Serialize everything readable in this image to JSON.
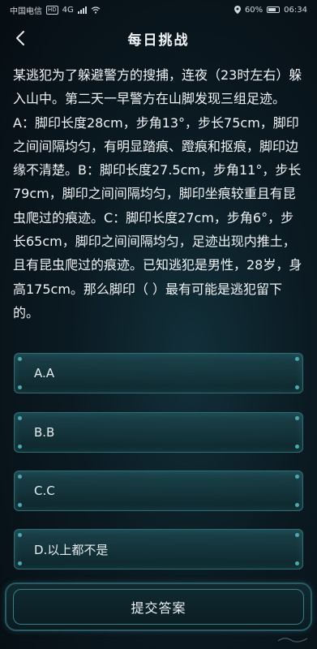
{
  "status_bar": {
    "carrier": "中国电信",
    "network_badge": "HD",
    "network_type": "4G",
    "battery": "60%",
    "time": "06:34"
  },
  "header": {
    "title": "每日挑战",
    "back_icon": "chevron-left-icon"
  },
  "question": {
    "text": "某逃犯为了躲避警方的搜捕，连夜（23时左右）躲入山中。第二天一早警方在山脚发现三组足迹。A：脚印长度28cm，步角13°，步长75cm，脚印之间间隔均匀，有明显踏痕、蹬痕和抠痕，脚印边缘不清楚。B：脚印长度27.5cm，步角11°，步长79cm，脚印之间间隔均匀，脚印坐痕较重且有昆虫爬过的痕迹。C：脚印长度27cm，步角6°，步长65cm，脚印之间间隔均匀，足迹出现内推土，且有昆虫爬过的痕迹。已知逃犯是男性，28岁，身高175cm。那么脚印（ ）最有可能是逃犯留下的。"
  },
  "options": [
    {
      "label": "A.A"
    },
    {
      "label": "B.B"
    },
    {
      "label": "C.C"
    },
    {
      "label": "D.以上都不是"
    }
  ],
  "submit": {
    "label": "提交答案"
  },
  "colors": {
    "accent": "#2c6e74",
    "background": "#0b1a22",
    "text": "#f0f3f5"
  }
}
